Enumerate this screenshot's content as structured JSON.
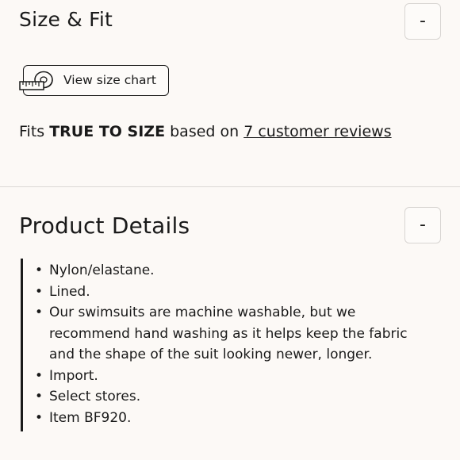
{
  "size_fit": {
    "title": "Size & Fit",
    "toggle_label": "-",
    "size_chart_label": "View size chart",
    "size_chart_icon": "measuring-tape-icon",
    "fits_prefix": "Fits ",
    "fits_value": "TRUE TO SIZE",
    "fits_middle": " based on ",
    "reviews_link": "7 customer reviews"
  },
  "product_details": {
    "title": "Product Details",
    "toggle_label": "-",
    "items": [
      "Nylon/elastane.",
      "Lined.",
      "Our swimsuits are machine washable, but we recommend hand washing as it helps keep the fabric and the shape of the suit looking newer, longer.",
      "Import.",
      "Select stores.",
      "Item BF920."
    ]
  },
  "colors": {
    "background": "#fcf9f6",
    "text": "#1a1a1a",
    "divider": "#dcd9d6"
  }
}
